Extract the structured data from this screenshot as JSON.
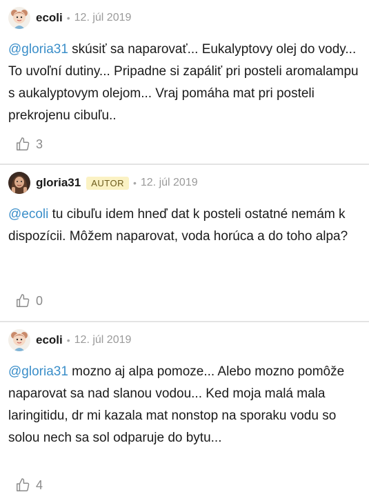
{
  "comments": [
    {
      "author": "ecoli",
      "badge": "",
      "separator": "•",
      "date": "12. júl 2019",
      "mention": "@gloria31",
      "text": " skúsiť sa naparovať... Eukalyptovy olej do vody... To uvoľní dutiny... Pripadne si zapáliť pri posteli aromalampu s aukalyptovym olejom... Vraj pomáha mat pri posteli prekrojenu cibuľu..",
      "likes": "3"
    },
    {
      "author": "gloria31",
      "badge": "AUTOR",
      "separator": "•",
      "date": "12. júl 2019",
      "mention": "@ecoli",
      "text": " tu cibuľu idem hneď dat k posteli ostatné nemám k dispozícii. Môžem naparovat, voda horúca a do toho alpa?",
      "likes": "0"
    },
    {
      "author": "ecoli",
      "badge": "",
      "separator": "•",
      "date": "12. júl 2019",
      "mention": "@gloria31",
      "text": " mozno aj alpa pomoze... Alebo mozno pomôže naparovat sa nad slanou vodou... Ked moja malá mala laringitidu, dr mi kazala mat nonstop na sporaku vodu so solou nech sa sol odparuje do bytu...",
      "likes": "4"
    }
  ],
  "colors": {
    "mention": "#3a8ec9",
    "badge_bg": "#fbf2c4",
    "divider": "#e3e3e3"
  },
  "icons": {
    "like": "thumbs-up-outline-icon",
    "avatar_ecoli": "cartoon-girl-avatar",
    "avatar_gloria": "photo-avatar"
  }
}
